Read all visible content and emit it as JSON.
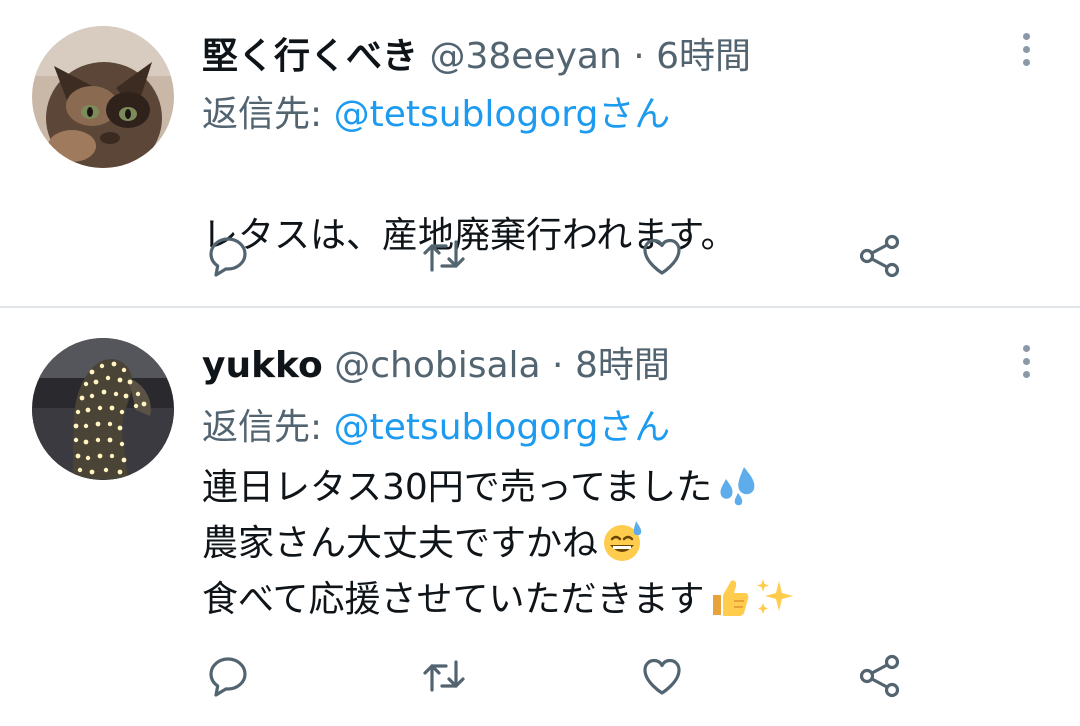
{
  "colors": {
    "text": "#0f1419",
    "secondary": "#536471",
    "link": "#1d9bf0",
    "divider": "#e1e4e8"
  },
  "tweets": [
    {
      "display_name": "堅く行くべき",
      "handle": "@38eeyan",
      "separator": "·",
      "time": "6時間",
      "reply_prefix": "返信先: ",
      "reply_to": "@tetsublogorgさん",
      "lines": [
        "レタスは、産地廃棄行われます。"
      ],
      "avatar": "cat-photo-avatar"
    },
    {
      "display_name": "yukko",
      "handle": "@chobisala",
      "separator": "·",
      "time": "8時間",
      "reply_prefix": "返信先: ",
      "reply_to": "@tetsublogorgさん",
      "lines": [
        "連日レタス30円で売ってました",
        "農家さん大丈夫ですかね",
        "食べて応援させていただきます"
      ],
      "emojis": [
        "sweat-droplets-emoji",
        "grinning-sweat-emoji",
        "thumbs-up-emoji",
        "sparkles-emoji"
      ],
      "avatar": "lights-photo-avatar"
    }
  ],
  "icons": {
    "reply": "reply-icon",
    "retweet": "retweet-icon",
    "like": "heart-icon",
    "share": "share-icon",
    "more": "more-icon"
  }
}
